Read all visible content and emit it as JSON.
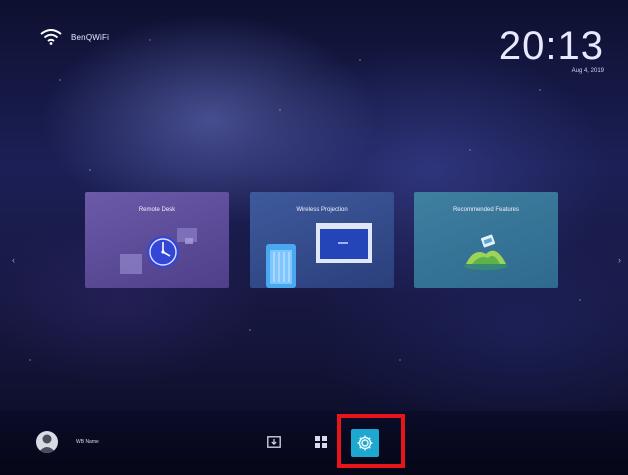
{
  "status": {
    "wifi_name": "BenQWiFi",
    "time": "20:13",
    "date": "Aug 4, 2019"
  },
  "tiles": [
    {
      "label": "Remote Desk"
    },
    {
      "label": "Wireless Projection"
    },
    {
      "label": "Recommended Features"
    }
  ],
  "user": {
    "name": "WB Name"
  },
  "dock": {
    "input_icon": "input-source-icon",
    "apps_icon": "apps-grid-icon",
    "settings_icon": "settings-gear-icon"
  },
  "colors": {
    "highlight": "#e8141c",
    "settings_accent": "#1ea7cf"
  }
}
